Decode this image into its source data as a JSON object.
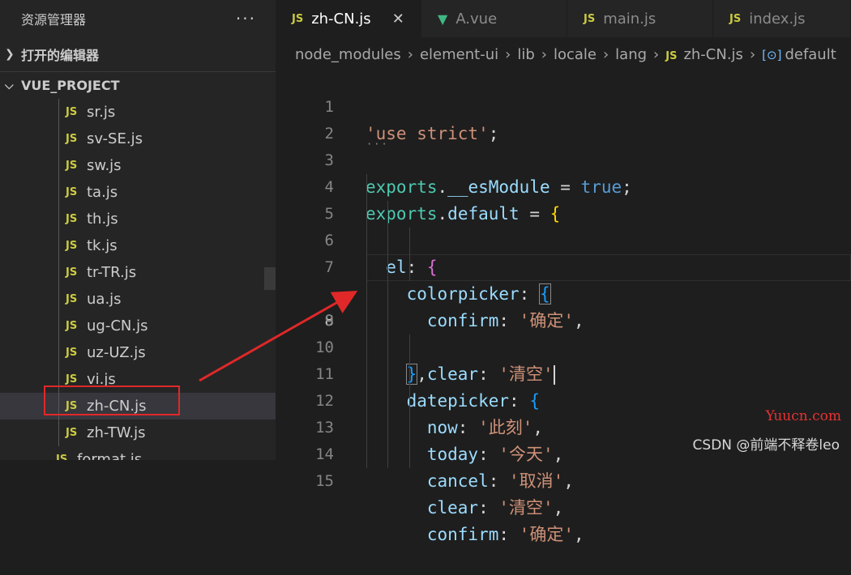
{
  "explorer": {
    "title": "资源管理器",
    "more_icon": "ellipsis-icon",
    "open_editors_label": "打开的编辑器",
    "project_label": "VUE_PROJECT",
    "files": [
      "sr.js",
      "sv-SE.js",
      "sw.js",
      "ta.js",
      "th.js",
      "tk.js",
      "tr-TR.js",
      "ua.js",
      "ug-CN.js",
      "uz-UZ.js",
      "vi.js",
      "zh-CN.js",
      "zh-TW.js",
      "format.js"
    ],
    "selected_file": "zh-CN.js",
    "file_icon_label": "JS"
  },
  "tabs": [
    {
      "label": "zh-CN.js",
      "icon": "JS",
      "active": true
    },
    {
      "label": "A.vue",
      "icon": "V",
      "active": false
    },
    {
      "label": "main.js",
      "icon": "JS",
      "active": false
    },
    {
      "label": "index.js",
      "icon": "JS",
      "active": false
    }
  ],
  "breadcrumb": [
    "node_modules",
    "element-ui",
    "lib",
    "locale",
    "lang",
    "zh-CN.js",
    "default"
  ],
  "editor": {
    "current_line": 8,
    "line_numbers": [
      "1",
      "2",
      "3",
      "4",
      "5",
      "6",
      "7",
      "8",
      "9",
      "10",
      "11",
      "12",
      "13",
      "14",
      "15"
    ]
  },
  "watermarks": {
    "site": "Yuucn.com",
    "author": "CSDN @前端不释卷leo"
  },
  "colors": {
    "background": "#1e1e1e",
    "sidebar": "#252526",
    "string": "#ce9178",
    "keyword": "#569cd6",
    "highlight_box": "#e02828"
  }
}
